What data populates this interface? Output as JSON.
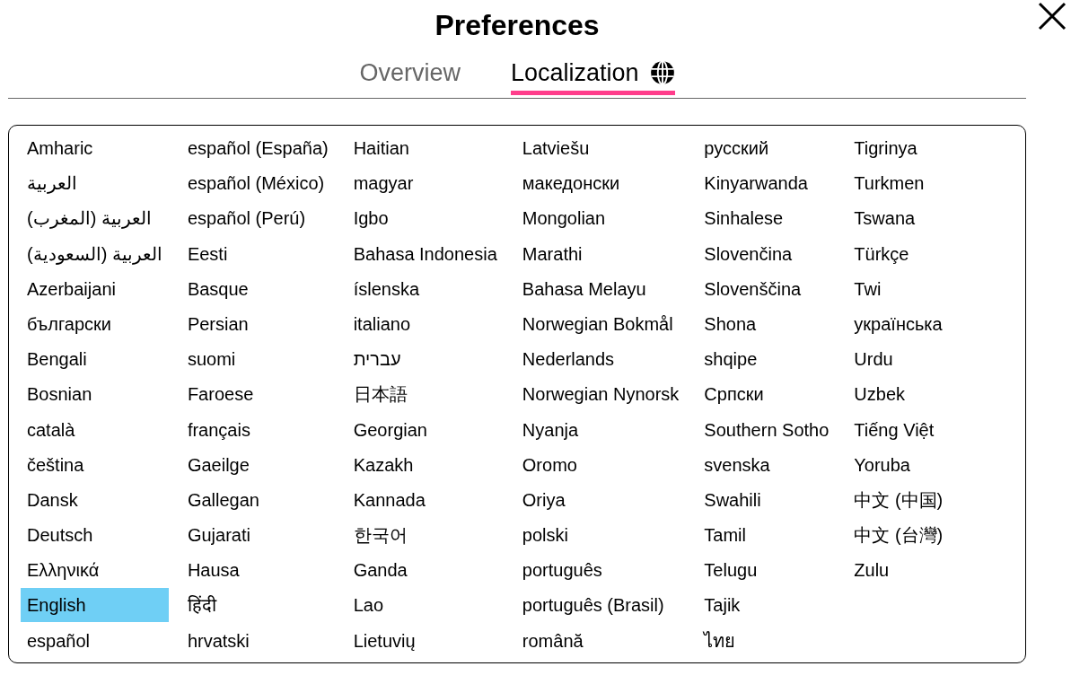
{
  "window": {
    "title": "Preferences"
  },
  "tabs": [
    {
      "label": "Overview",
      "selected": false,
      "has_icon": false
    },
    {
      "label": "Localization",
      "selected": true,
      "has_icon": true
    }
  ],
  "languages": [
    {
      "label": "Amharic",
      "selected": false
    },
    {
      "label": "العربية",
      "selected": false
    },
    {
      "label": "العربية (المغرب)",
      "selected": false
    },
    {
      "label": "العربية (السعودية)",
      "selected": false
    },
    {
      "label": "Azerbaijani",
      "selected": false
    },
    {
      "label": "български",
      "selected": false
    },
    {
      "label": "Bengali",
      "selected": false
    },
    {
      "label": "Bosnian",
      "selected": false
    },
    {
      "label": "català",
      "selected": false
    },
    {
      "label": "čeština",
      "selected": false
    },
    {
      "label": "Dansk",
      "selected": false
    },
    {
      "label": "Deutsch",
      "selected": false
    },
    {
      "label": "Ελληνικά",
      "selected": false
    },
    {
      "label": "English",
      "selected": true
    },
    {
      "label": "español",
      "selected": false
    },
    {
      "label": "español (España)",
      "selected": false
    },
    {
      "label": "español (México)",
      "selected": false
    },
    {
      "label": "español (Perú)",
      "selected": false
    },
    {
      "label": "Eesti",
      "selected": false
    },
    {
      "label": "Basque",
      "selected": false
    },
    {
      "label": "Persian",
      "selected": false
    },
    {
      "label": "suomi",
      "selected": false
    },
    {
      "label": "Faroese",
      "selected": false
    },
    {
      "label": "français",
      "selected": false
    },
    {
      "label": "Gaeilge",
      "selected": false
    },
    {
      "label": "Gallegan",
      "selected": false
    },
    {
      "label": "Gujarati",
      "selected": false
    },
    {
      "label": "Hausa",
      "selected": false
    },
    {
      "label": "हिंदी",
      "selected": false
    },
    {
      "label": "hrvatski",
      "selected": false
    },
    {
      "label": "Haitian",
      "selected": false
    },
    {
      "label": "magyar",
      "selected": false
    },
    {
      "label": "Igbo",
      "selected": false
    },
    {
      "label": "Bahasa Indonesia",
      "selected": false
    },
    {
      "label": "íslenska",
      "selected": false
    },
    {
      "label": "italiano",
      "selected": false
    },
    {
      "label": "עברית",
      "selected": false
    },
    {
      "label": "日本語",
      "selected": false
    },
    {
      "label": "Georgian",
      "selected": false
    },
    {
      "label": "Kazakh",
      "selected": false
    },
    {
      "label": "Kannada",
      "selected": false
    },
    {
      "label": "한국어",
      "selected": false
    },
    {
      "label": "Ganda",
      "selected": false
    },
    {
      "label": "Lao",
      "selected": false
    },
    {
      "label": "Lietuvių",
      "selected": false
    },
    {
      "label": "Latviešu",
      "selected": false
    },
    {
      "label": "македонски",
      "selected": false
    },
    {
      "label": "Mongolian",
      "selected": false
    },
    {
      "label": "Marathi",
      "selected": false
    },
    {
      "label": "Bahasa Melayu",
      "selected": false
    },
    {
      "label": "Norwegian Bokmål",
      "selected": false
    },
    {
      "label": "Nederlands",
      "selected": false
    },
    {
      "label": "Norwegian Nynorsk",
      "selected": false
    },
    {
      "label": "Nyanja",
      "selected": false
    },
    {
      "label": "Oromo",
      "selected": false
    },
    {
      "label": "Oriya",
      "selected": false
    },
    {
      "label": "polski",
      "selected": false
    },
    {
      "label": "português",
      "selected": false
    },
    {
      "label": "português (Brasil)",
      "selected": false
    },
    {
      "label": "română",
      "selected": false
    },
    {
      "label": "русский",
      "selected": false
    },
    {
      "label": "Kinyarwanda",
      "selected": false
    },
    {
      "label": "Sinhalese",
      "selected": false
    },
    {
      "label": "Slovenčina",
      "selected": false
    },
    {
      "label": "Slovenščina",
      "selected": false
    },
    {
      "label": "Shona",
      "selected": false
    },
    {
      "label": "shqipe",
      "selected": false
    },
    {
      "label": "Српски",
      "selected": false
    },
    {
      "label": "Southern Sotho",
      "selected": false
    },
    {
      "label": "svenska",
      "selected": false
    },
    {
      "label": "Swahili",
      "selected": false
    },
    {
      "label": "Tamil",
      "selected": false
    },
    {
      "label": "Telugu",
      "selected": false
    },
    {
      "label": "Tajik",
      "selected": false
    },
    {
      "label": "ไทย",
      "selected": false
    },
    {
      "label": "Tigrinya",
      "selected": false
    },
    {
      "label": "Turkmen",
      "selected": false
    },
    {
      "label": "Tswana",
      "selected": false
    },
    {
      "label": "Türkçe",
      "selected": false
    },
    {
      "label": "Twi",
      "selected": false
    },
    {
      "label": "українська",
      "selected": false
    },
    {
      "label": "Urdu",
      "selected": false
    },
    {
      "label": "Uzbek",
      "selected": false
    },
    {
      "label": "Tiếng Việt",
      "selected": false
    },
    {
      "label": "Yoruba",
      "selected": false
    },
    {
      "label": "中文 (中国)",
      "selected": false
    },
    {
      "label": "中文 (台灣)",
      "selected": false
    },
    {
      "label": "Zulu",
      "selected": false
    }
  ]
}
